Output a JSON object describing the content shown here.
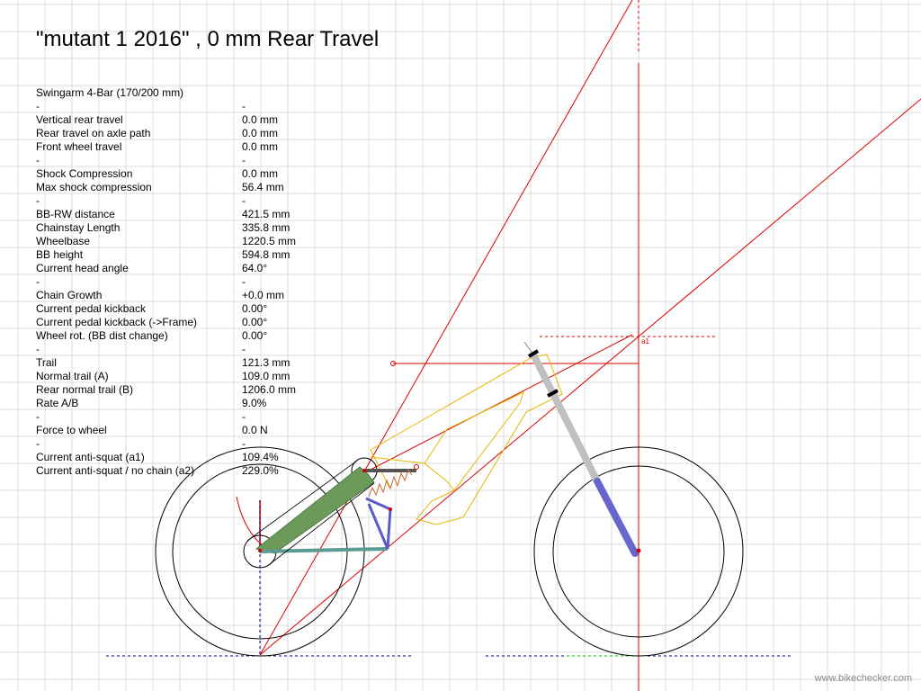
{
  "title": "\"mutant 1 2016\" , 0 mm Rear Travel",
  "stats": [
    {
      "label": "Swingarm 4-Bar (170/200 mm)",
      "value": ""
    },
    {
      "label": "-",
      "value": "-"
    },
    {
      "label": "Vertical rear travel",
      "value": "0.0 mm"
    },
    {
      "label": "Rear travel on axle path",
      "value": "0.0 mm"
    },
    {
      "label": "Front wheel travel",
      "value": "0.0 mm"
    },
    {
      "label": "-",
      "value": "-"
    },
    {
      "label": "Shock Compression",
      "value": "0.0 mm"
    },
    {
      "label": "Max shock compression",
      "value": "56.4 mm"
    },
    {
      "label": "-",
      "value": "-"
    },
    {
      "label": "BB-RW distance",
      "value": "421.5 mm"
    },
    {
      "label": "Chainstay Length",
      "value": "335.8 mm"
    },
    {
      "label": "Wheelbase",
      "value": "1220.5 mm"
    },
    {
      "label": "BB height",
      "value": "594.8 mm"
    },
    {
      "label": "Current head angle",
      "value": "64.0°"
    },
    {
      "label": "-",
      "value": "-"
    },
    {
      "label": "Chain Growth",
      "value": "+0.0 mm"
    },
    {
      "label": "Current pedal kickback",
      "value": "0.00°"
    },
    {
      "label": "Current pedal kickback (->Frame)",
      "value": "0.00°"
    },
    {
      "label": "Wheel rot. (BB dist change)",
      "value": "0.00°"
    },
    {
      "label": "-",
      "value": "-"
    },
    {
      "label": "Trail",
      "value": "121.3 mm"
    },
    {
      "label": "Normal trail (A)",
      "value": "109.0 mm"
    },
    {
      "label": "Rear normal trail (B)",
      "value": "1206.0 mm"
    },
    {
      "label": "Rate A/B",
      "value": "9.0%"
    },
    {
      "label": "-",
      "value": "-"
    },
    {
      "label": "Force to wheel",
      "value": "0.0 N"
    },
    {
      "label": "-",
      "value": "-"
    },
    {
      "label": "Current anti-squat (a1)",
      "value": "109.4%"
    },
    {
      "label": "Current anti-squat / no chain (a2)",
      "value": "229.0%"
    }
  ],
  "marker_label": "a1",
  "watermark": "www.bikechecker.com",
  "colors": {
    "grid": "#dcdcdc",
    "construction": "#dd0000",
    "frame": "#e6b800",
    "swingarm": "#6b9a5b",
    "link": "#5b9a92",
    "rocker": "#5a5ac8",
    "shock": "#555555",
    "fork_upper": "#c0c0c0",
    "fork_lower": "#6666cc",
    "ground": "#000080",
    "front_ground": "#00c000"
  }
}
